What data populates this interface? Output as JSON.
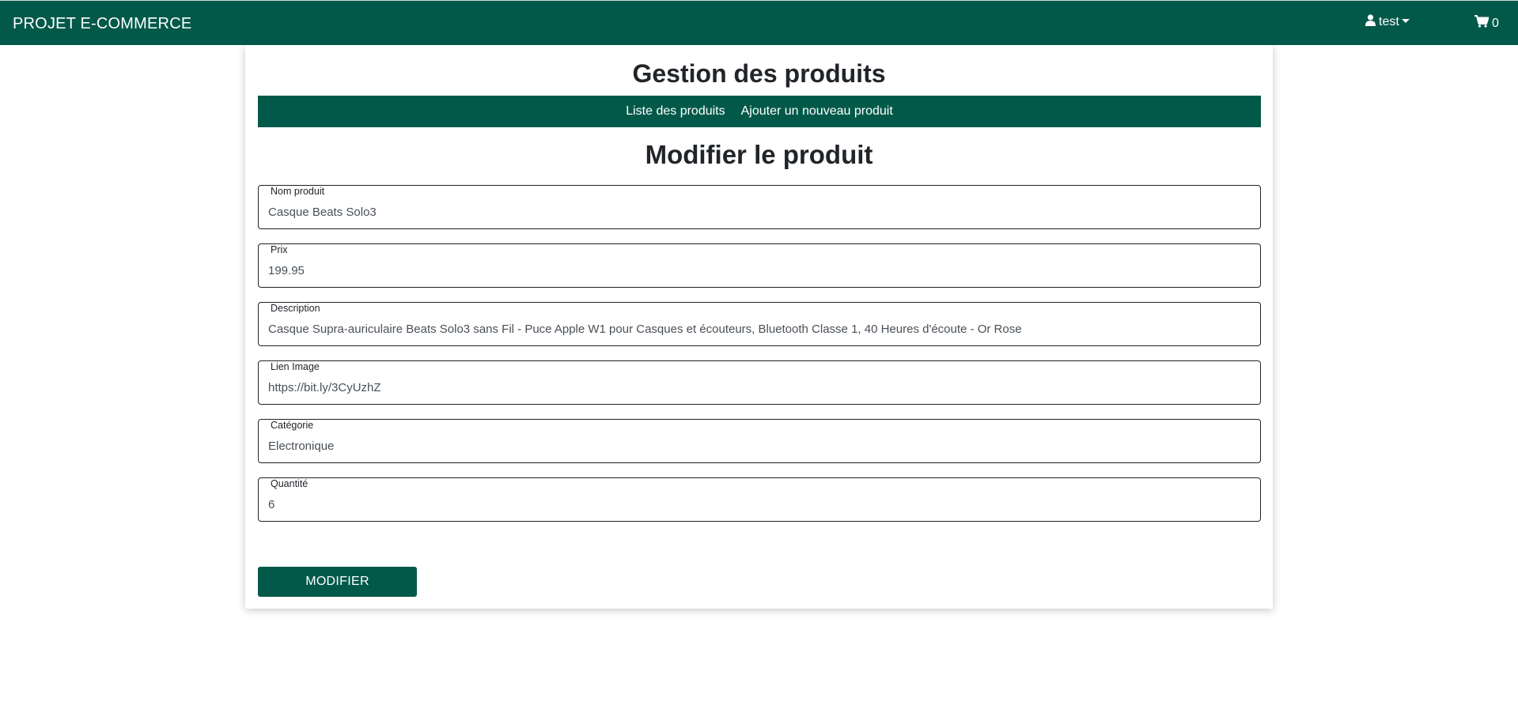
{
  "navbar": {
    "brand": "PROJET E-COMMERCE",
    "user_label": "test",
    "user_icon": "user-icon",
    "cart_icon": "shopping-cart-icon",
    "cart_count": "0",
    "bg_color": "#02594a"
  },
  "page": {
    "title": "Gestion des produits",
    "subnav": {
      "list_label": "Liste des produits",
      "add_label": "Ajouter un nouveau produit"
    },
    "form_title": "Modifier le produit"
  },
  "form": {
    "fields": [
      {
        "label": "Nom produit",
        "value": "Casque Beats Solo3"
      },
      {
        "label": "Prix",
        "value": "199.95"
      },
      {
        "label": "Description",
        "value": "Casque Supra-auriculaire Beats Solo3 sans Fil - Puce Apple W1 pour Casques et écouteurs, Bluetooth Classe 1, 40 Heures d'écoute - Or Rose"
      },
      {
        "label": "Lien Image",
        "value": "https://bit.ly/3CyUzhZ"
      },
      {
        "label": "Catégorie",
        "value": "Electronique"
      },
      {
        "label": "Quantité",
        "value": "6"
      }
    ],
    "submit_label": "MODIFIER"
  }
}
